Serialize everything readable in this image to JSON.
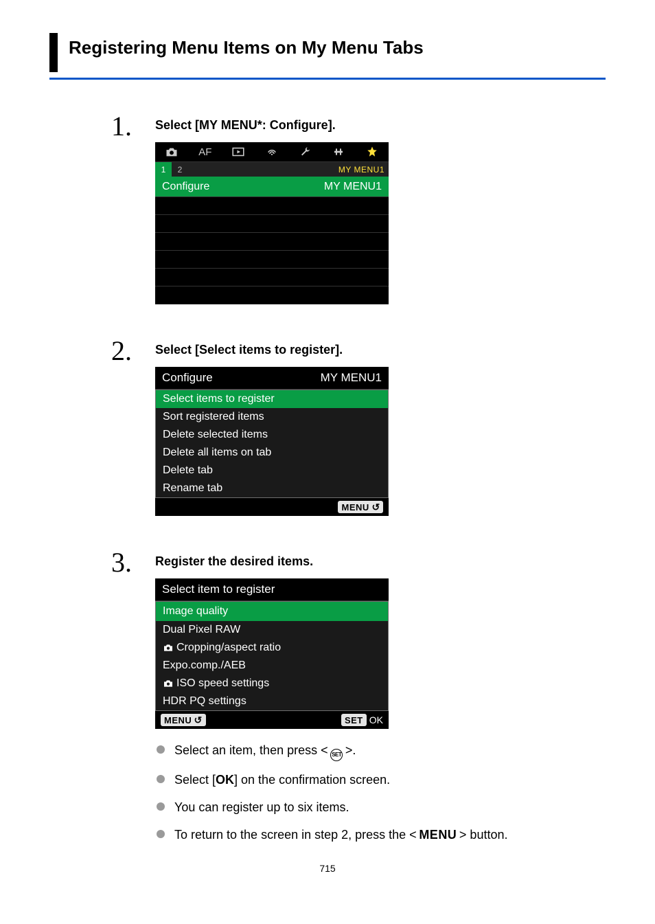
{
  "section_title": "Registering Menu Items on My Menu Tabs",
  "page_number": "715",
  "steps": [
    {
      "num": "1",
      "title_pre": "Select [",
      "title_bold": "MY MENU*: Configure",
      "title_post": "].",
      "menu1": {
        "tabs": {
          "af": "AF",
          "menu_label": "MY MENU1",
          "subtabs": [
            "1",
            "2"
          ]
        },
        "head_item": {
          "label": "Configure",
          "value": "MY MENU1"
        }
      }
    },
    {
      "num": "2",
      "title_pre": "Select [",
      "title_bold": "Select items to register",
      "title_post": "].",
      "menu2": {
        "head": {
          "label": "Configure",
          "value": "MY MENU1"
        },
        "items": [
          "Select items to register",
          "Sort registered items",
          "Delete selected items",
          "Delete all items on tab",
          "Delete tab",
          "Rename tab"
        ],
        "back_pill": "MENU"
      }
    },
    {
      "num": "3",
      "title_plain": "Register the desired items.",
      "menu3": {
        "head": {
          "label": "Select item to register"
        },
        "items": [
          {
            "label": "Image quality",
            "icon": null,
            "hl": true
          },
          {
            "label": "Dual Pixel RAW",
            "icon": null
          },
          {
            "label": "Cropping/aspect ratio",
            "icon": "camera"
          },
          {
            "label": "Expo.comp./AEB",
            "icon": null
          },
          {
            "label": "ISO speed settings",
            "icon": "camera"
          },
          {
            "label": "HDR PQ settings",
            "icon": null
          }
        ],
        "back_pill": "MENU",
        "ok_pill_left": "SET",
        "ok_pill_right": "OK"
      },
      "notes": {
        "n1_pre": "Select an item, then press < ",
        "n1_post": " >.",
        "n2_pre": "Select [",
        "n2_bold": "OK",
        "n2_post": "] on the confirmation screen.",
        "n3": "You can register up to six items.",
        "n4_pre": "To return to the screen in step 2, press the < ",
        "n4_mid": "MENU",
        "n4_post": " > button."
      }
    }
  ]
}
